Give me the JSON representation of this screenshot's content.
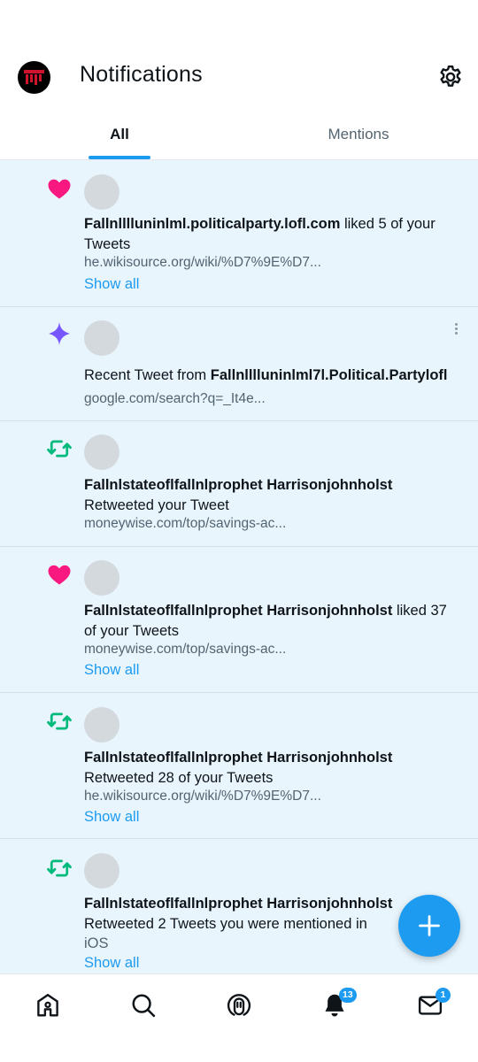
{
  "header": {
    "title": "Notifications",
    "settings_icon": "gear-icon"
  },
  "tabs": [
    {
      "label": "All",
      "active": true
    },
    {
      "label": "Mentions",
      "active": false
    }
  ],
  "notifications": [
    {
      "type": "like",
      "icon": "heart-icon",
      "user": "Fallnlllluninlml.politicalparty.lofl.com",
      "action": " liked 5 of your Tweets",
      "link": "he.wikisource.org/wiki/%D7%9E%D7...",
      "show_all": "Show all"
    },
    {
      "type": "recent",
      "icon": "sparkle-icon",
      "prefix": "Recent Tweet from ",
      "user": "Fallnlllluninlml7l.Political.Partylofl",
      "link": "google.com/search?q=_It4e..."
    },
    {
      "type": "retweet",
      "icon": "retweet-icon",
      "user": "Fallnlstateoflfallnlprophet Harrisonjohnholst",
      "action": "Retweeted your Tweet",
      "link": "moneywise.com/top/savings-ac..."
    },
    {
      "type": "like",
      "icon": "heart-icon",
      "user": "Fallnlstateoflfallnlprophet Harrisonjohnholst",
      "action": " liked 37 of your Tweets",
      "link": "moneywise.com/top/savings-ac...",
      "show_all": "Show all"
    },
    {
      "type": "retweet",
      "icon": "retweet-icon",
      "user": "Fallnlstateoflfallnlprophet Harrisonjohnholst",
      "action": "Retweeted 28 of your Tweets",
      "link": "he.wikisource.org/wiki/%D7%9E%D7...",
      "show_all": "Show all"
    },
    {
      "type": "retweet",
      "icon": "retweet-icon",
      "user": "Fallnlstateoflfallnlprophet Harrisonjohnholst",
      "action": "Retweeted 2 Tweets you were mentioned in",
      "action_line2": "iOS",
      "show_all": "Show all"
    }
  ],
  "fab": {
    "icon": "plus-icon"
  },
  "bottom_nav": {
    "home_icon": "home-icon",
    "search_icon": "search-icon",
    "spaces_icon": "spaces-microphone-icon",
    "notifications_icon": "bell-icon",
    "notifications_badge": "13",
    "messages_icon": "envelope-icon",
    "messages_badge": "1"
  },
  "colors": {
    "accent": "#1d9bf0",
    "unread_background": "#e8f5fd",
    "like": "#f91880",
    "retweet": "#00ba7c",
    "sparkle": "#7856ff",
    "secondary_text": "#536471"
  }
}
